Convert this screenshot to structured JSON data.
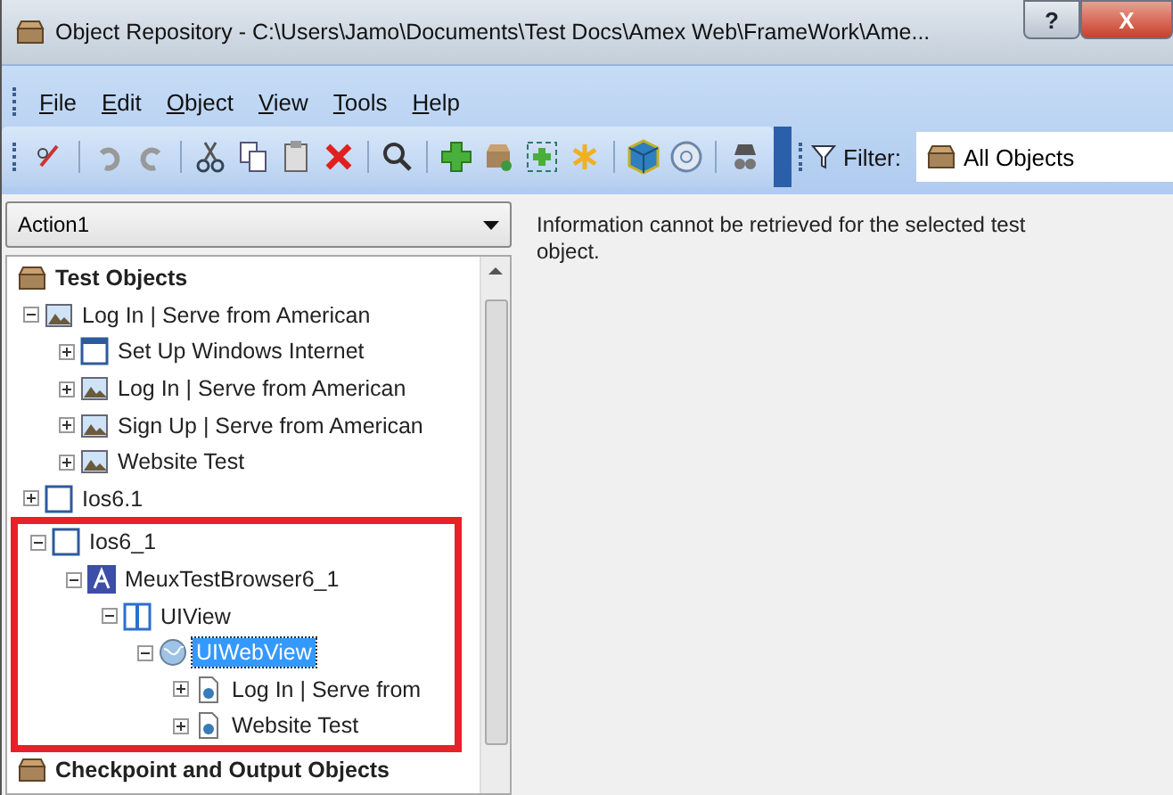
{
  "window": {
    "title": "Object Repository - C:\\Users\\Jamo\\Documents\\Test Docs\\Amex Web\\FrameWork\\Ame...",
    "buttons": [
      "?",
      "X"
    ]
  },
  "menu": [
    "File",
    "Edit",
    "Object",
    "View",
    "Tools",
    "Help"
  ],
  "filter": {
    "label": "Filter:",
    "value": "All Objects"
  },
  "action": {
    "value": "Action1"
  },
  "tree": {
    "root": "Test Objects",
    "items": [
      {
        "label": "Log In | Serve from American",
        "kind": "page",
        "expanded": true,
        "selected": false,
        "children": [
          {
            "label": "Set Up Windows Internet",
            "kind": "window",
            "expanded": false,
            "selected": false
          },
          {
            "label": "Log In | Serve from American",
            "kind": "page",
            "expanded": false,
            "selected": false
          },
          {
            "label": "Sign Up | Serve from American",
            "kind": "page",
            "expanded": false,
            "selected": false
          },
          {
            "label": "Website Test",
            "kind": "page",
            "expanded": false,
            "selected": false
          }
        ]
      },
      {
        "label": "Ios6.1",
        "kind": "device",
        "expanded": false,
        "selected": false
      },
      {
        "label": "Ios6_1",
        "kind": "device",
        "expanded": true,
        "selected": false,
        "highlighted": true,
        "children": [
          {
            "label": "MeuxTestBrowser6_1",
            "kind": "app",
            "expanded": true,
            "selected": false,
            "children": [
              {
                "label": "UIView",
                "kind": "view",
                "expanded": true,
                "selected": false,
                "children": [
                  {
                    "label": "UIWebView",
                    "kind": "globe",
                    "expanded": true,
                    "selected": true,
                    "children": [
                      {
                        "label": "Log In | Serve from",
                        "kind": "doc",
                        "expanded": false,
                        "selected": false
                      },
                      {
                        "label": "Website Test",
                        "kind": "doc",
                        "expanded": false,
                        "selected": false
                      }
                    ]
                  }
                ]
              }
            ]
          }
        ]
      }
    ],
    "next_root": "Checkpoint and Output Objects"
  },
  "details": {
    "message": "Information cannot be retrieved for the selected test object."
  }
}
